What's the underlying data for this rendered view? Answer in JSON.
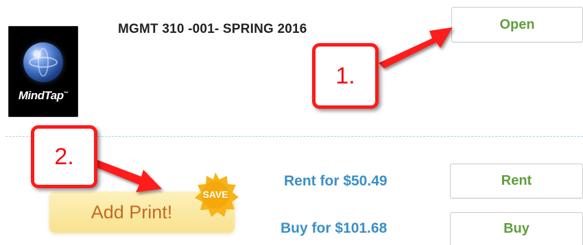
{
  "course": {
    "title": "MGMT 310 -001- SPRING 2016"
  },
  "logo": {
    "text": "MindTap",
    "tm": "™",
    "icon": "globe-icon"
  },
  "actions": {
    "open_label": "Open",
    "rent_label": "Rent",
    "buy_label": "Buy"
  },
  "pricing": {
    "rent_text": "Rent for $50.49",
    "buy_text": "Buy for $101.68"
  },
  "print_offer": {
    "label": "Add Print!",
    "badge": "SAVE"
  },
  "annotations": {
    "step1": "1.",
    "step2": "2."
  },
  "colors": {
    "accent_green": "#5f9e3c",
    "price_blue": "#3a8fc9",
    "callout_red": "#ff1a1a",
    "add_print_orange": "#c46a22",
    "badge_gold": "#f7b318"
  }
}
